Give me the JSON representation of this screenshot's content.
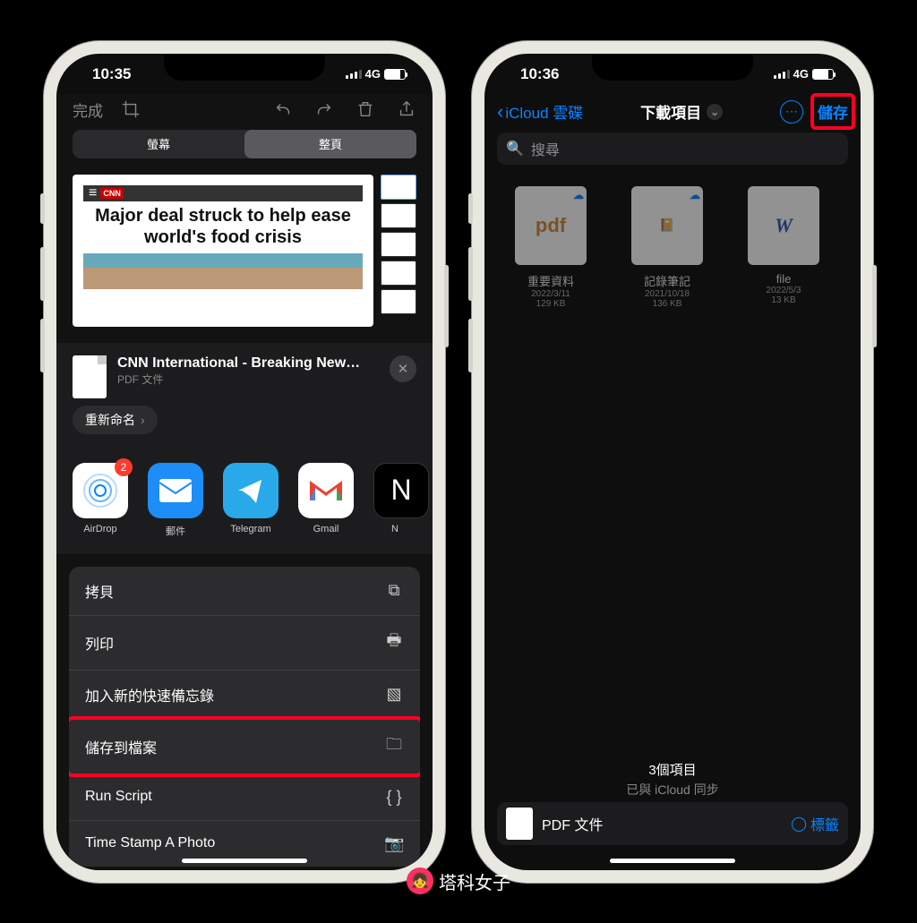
{
  "left": {
    "status": {
      "time": "10:35",
      "network": "4G"
    },
    "toolbar": {
      "done": "完成"
    },
    "segments": {
      "screen": "螢幕",
      "full": "整頁"
    },
    "preview": {
      "source_badge": "CNN",
      "headline": "Major deal struck to help ease world's food crisis"
    },
    "sheet": {
      "title": "CNN International - Breaking News, US...",
      "subtitle": "PDF 文件",
      "rename": "重新命名"
    },
    "share_apps": {
      "airdrop": "AirDrop",
      "airdrop_badge": "2",
      "mail": "郵件",
      "telegram": "Telegram",
      "gmail": "Gmail"
    },
    "actions": {
      "copy": "拷貝",
      "print": "列印",
      "quicknote": "加入新的快速備忘錄",
      "savefiles": "儲存到檔案",
      "runscript": "Run Script",
      "timestamp": "Time Stamp A Photo"
    }
  },
  "right": {
    "status": {
      "time": "10:36",
      "network": "4G"
    },
    "nav": {
      "back": "iCloud 雲碟",
      "title": "下載項目",
      "save": "儲存"
    },
    "search_placeholder": "搜尋",
    "files": [
      {
        "label": "pdf",
        "name": "重要資料",
        "date": "2022/3/11",
        "size": "129 KB",
        "color": "#d18a3a"
      },
      {
        "label": "📄",
        "name": "記錄筆記",
        "date": "2021/10/18",
        "size": "136 KB",
        "color": "#fff"
      },
      {
        "label": "W",
        "name": "file",
        "date": "2022/5/3",
        "size": "13 KB",
        "color": "#2a5db0"
      }
    ],
    "footer": {
      "count": "3個項目",
      "sync": "已與 iCloud 同步"
    },
    "bottombar": {
      "label": "PDF 文件",
      "tags": "標籤"
    }
  },
  "watermark": "塔科女子"
}
